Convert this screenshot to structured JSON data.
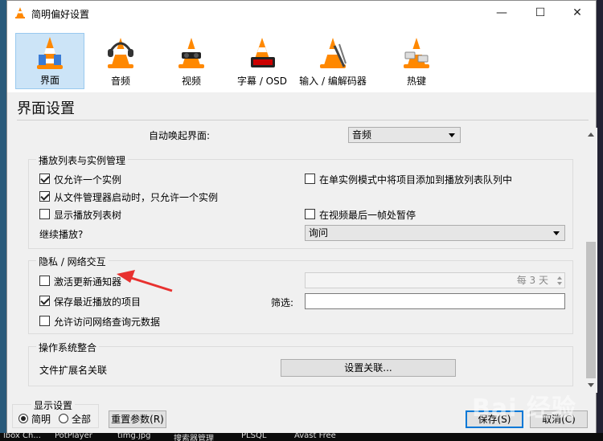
{
  "window": {
    "title": "简明偏好设置",
    "controls": [
      "—",
      "☐",
      "✕"
    ]
  },
  "categories": [
    {
      "label": "界面",
      "icon": "vlc-interface-icon",
      "active": true
    },
    {
      "label": "音频",
      "icon": "vlc-audio-icon"
    },
    {
      "label": "视频",
      "icon": "vlc-video-icon"
    },
    {
      "label": "字幕 / OSD",
      "icon": "vlc-subtitle-icon"
    },
    {
      "label": "输入 / 编解码器",
      "icon": "vlc-codec-icon"
    },
    {
      "label": "热键",
      "icon": "vlc-hotkeys-icon"
    }
  ],
  "section_title": "界面设置",
  "top_row": {
    "label": "自动唤起界面:",
    "value": "音频"
  },
  "playlist_group": {
    "title": "播放列表与实例管理",
    "allow_one_instance": "仅允许一个实例",
    "file_manager_one_instance": "从文件管理器启动时，只允许一个实例",
    "show_playlist_tree": "显示播放列表树",
    "enqueue_single_instance": "在单实例模式中将项目添加到播放列表队列中",
    "pause_last_frame": "在视频最后一帧处暂停",
    "continue_label": "继续播放?",
    "continue_value": "询问"
  },
  "privacy_group": {
    "title": "隐私 / 网络交互",
    "update_notifier": "激活更新通知器",
    "update_interval": "每 3 天",
    "save_recent": "保存最近播放的项目",
    "filter_label": "筛选:",
    "filter_value": "",
    "allow_metadata": "允许访问网络查询元数据"
  },
  "os_group": {
    "title": "操作系统整合",
    "file_ext_label": "文件扩展名关联",
    "setup_button": "设置关联..."
  },
  "display_settings": {
    "title": "显示设置",
    "simple": "简明",
    "all": "全部"
  },
  "buttons": {
    "reset": "重置参数(R)",
    "save": "保存(S)",
    "cancel": "取消(C)"
  },
  "watermark": "Bai 经验",
  "taskbar": [
    "lbox Ch...",
    "PotPlayer",
    "timg.jpg",
    "搜索器管理",
    "PLSQL",
    "Avast Free"
  ],
  "colors": {
    "accent": "#0078d7",
    "active_tab": "#cce4f7",
    "annotation_arrow": "#e8312f"
  }
}
